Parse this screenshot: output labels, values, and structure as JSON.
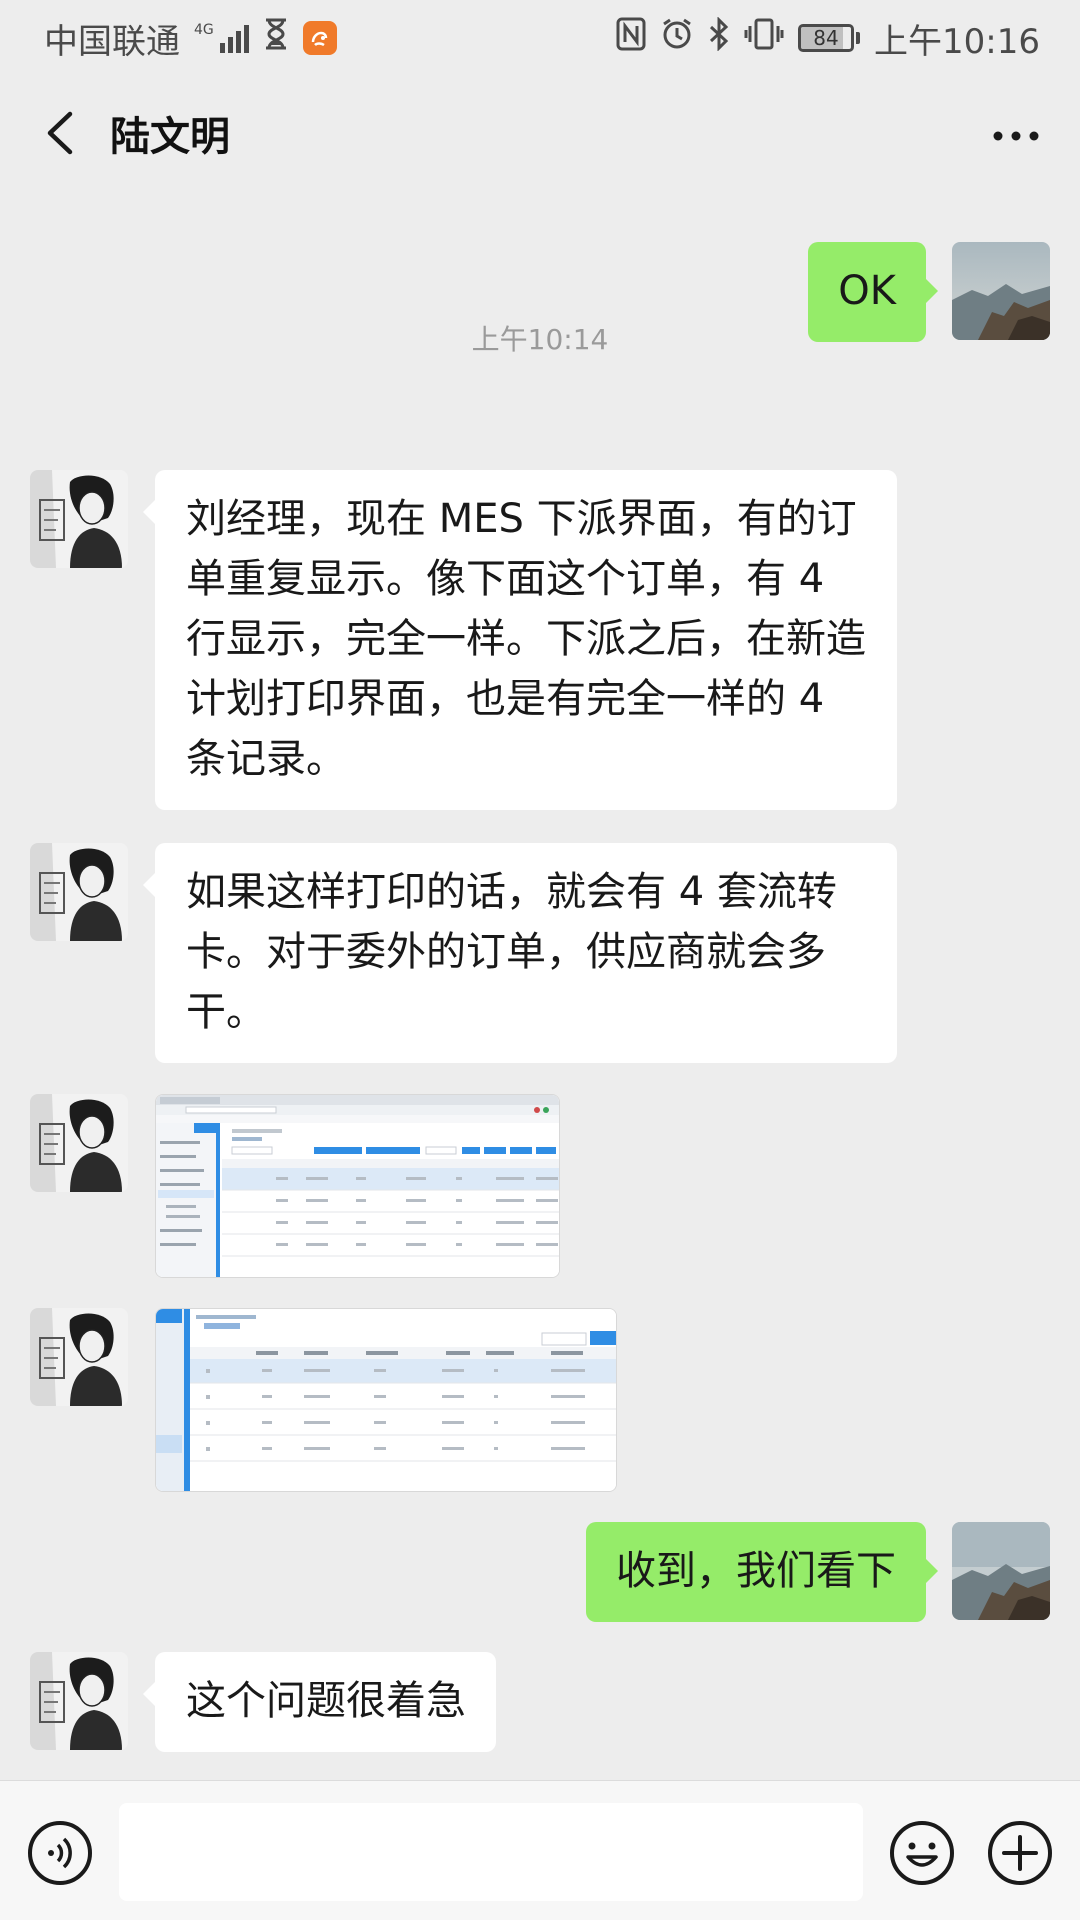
{
  "status_bar": {
    "carrier": "中国联通",
    "network": "4G",
    "battery": "84",
    "battery_level": 0.84,
    "time": "上午10:16",
    "icons": [
      "signal-icon",
      "hourglass-icon",
      "uc-browser-icon",
      "nfc-icon",
      "alarm-icon",
      "bluetooth-icon",
      "vibrate-icon",
      "battery-icon"
    ]
  },
  "header": {
    "title": "陆文明",
    "back_icon": "back-arrow-icon",
    "more_icon": "more-dots-icon"
  },
  "messages": [
    {
      "kind": "text",
      "direction": "out",
      "text": "OK"
    },
    {
      "kind": "time",
      "text": "上午10:14"
    },
    {
      "kind": "text",
      "direction": "in",
      "text": "刘经理，现在 MES 下派界面，有的订单重复显示。像下面这个订单，有 4 行显示，完全一样。下派之后，在新造计划打印界面，也是有完全一样的 4 条记录。"
    },
    {
      "kind": "text",
      "direction": "in",
      "text": "如果这样打印的话，就会有 4 套流转卡。对于委外的订单，供应商就会多干。"
    },
    {
      "kind": "image",
      "direction": "in",
      "content": "screenshot of order list with 4 duplicate rows"
    },
    {
      "kind": "image",
      "direction": "in",
      "content": "screenshot of print plan list with 4 duplicate records"
    },
    {
      "kind": "text",
      "direction": "out",
      "text": "收到，我们看下"
    },
    {
      "kind": "text",
      "direction": "in",
      "text": "这个问题很着急"
    }
  ],
  "input_bar": {
    "voice_icon": "voice-icon",
    "emoji_icon": "emoji-icon",
    "plus_icon": "plus-icon",
    "value": ""
  },
  "colors": {
    "background": "#ededed",
    "outgoing_bubble": "#95ec69",
    "incoming_bubble": "#ffffff"
  }
}
